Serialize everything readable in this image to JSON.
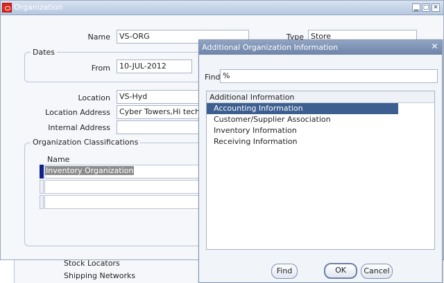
{
  "window": {
    "title": "Organization",
    "minimize": "▁",
    "maximize": "□",
    "close": "✕"
  },
  "form": {
    "name_label": "Name",
    "name_value": "VS-ORG",
    "type_label": "Type",
    "type_value": "Store",
    "dates_legend": "Dates",
    "from_label": "From",
    "from_value": "10-JUL-2012",
    "location_label": "Location",
    "location_value": "VS-Hyd",
    "location_address_label": "Location Address",
    "location_address_value": "Cyber Towers,Hi tech C",
    "internal_address_label": "Internal Address",
    "internal_address_value": "",
    "classifications_legend": "Organization Classifications",
    "classification_column": "Name",
    "classification_rows": [
      "Inventory Organization",
      "",
      ""
    ]
  },
  "background_list": [
    "Stock Locators",
    "Shipping Networks"
  ],
  "dialog": {
    "title": "Additional Organization Information",
    "close": "✕",
    "find_label": "Find",
    "find_value": "%",
    "list_header": "Additional Information",
    "items": [
      "Accounting Information",
      "Customer/Supplier Association",
      "Inventory Information",
      "Receiving Information"
    ],
    "selected_index": 0,
    "find_button": "Find",
    "ok_button": "OK",
    "cancel_button": "Cancel"
  },
  "colors": {
    "selection": "#3d5f8f",
    "title_bar": "#b6c7df",
    "dialog_title_bar": "#6e84a9",
    "oracle_red": "#e0231b"
  }
}
